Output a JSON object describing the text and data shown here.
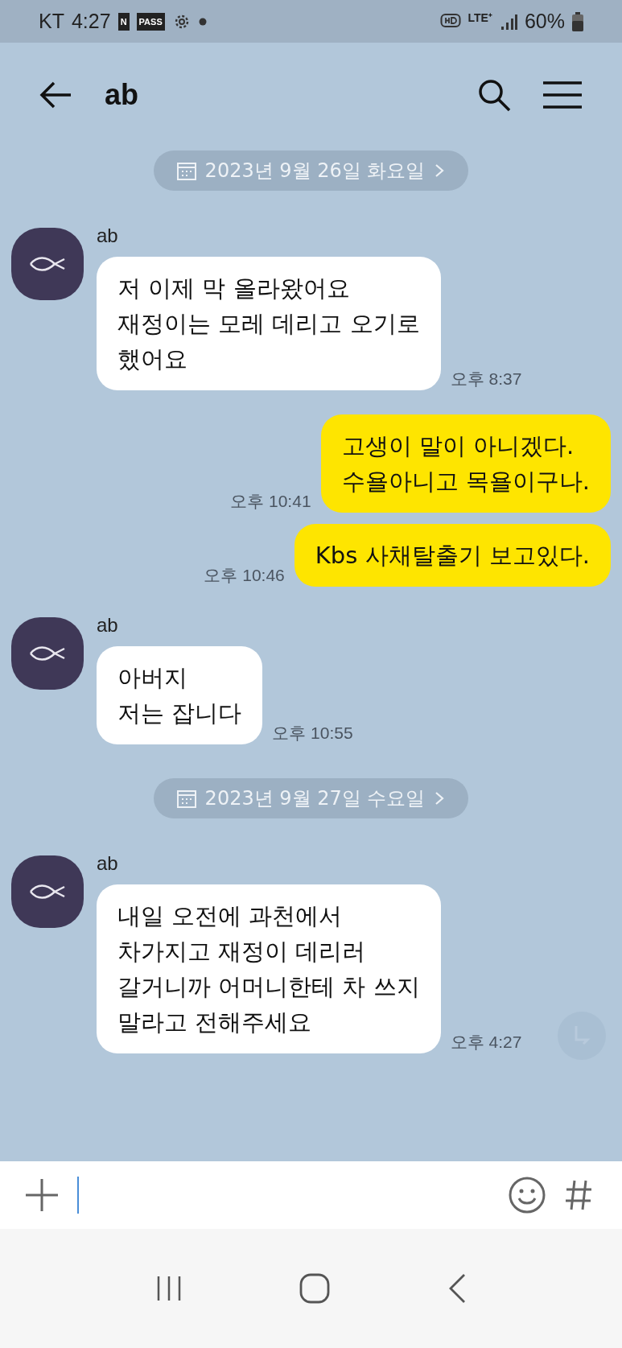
{
  "status_bar": {
    "carrier": "KT",
    "time": "4:27",
    "app_badges": [
      "N",
      "PASS"
    ],
    "battery": "60%",
    "network": "LTE⁺"
  },
  "header": {
    "title": "ab"
  },
  "messages": [
    {
      "kind": "date",
      "text": "2023년 9월 26일 화요일"
    },
    {
      "kind": "received",
      "sender": "ab",
      "lines": [
        "저 이제 막 올라왔어요",
        "재정이는 모레 데리고 오기로",
        "했어요"
      ],
      "time": "오후 8:37"
    },
    {
      "kind": "sent",
      "lines": [
        "고생이 말이 아니겠다.",
        "수욜아니고 목욜이구나."
      ],
      "time": "오후 10:41"
    },
    {
      "kind": "sent",
      "lines": [
        "Kbs 사채탈출기 보고있다."
      ],
      "time": "오후 10:46"
    },
    {
      "kind": "received",
      "sender": "ab",
      "lines": [
        "아버지",
        "저는 잡니다"
      ],
      "time": "오후 10:55"
    },
    {
      "kind": "date",
      "text": "2023년 9월 27일 수요일"
    },
    {
      "kind": "received",
      "sender": "ab",
      "lines": [
        "내일 오전에 과천에서",
        "차가지고 재정이 데리러",
        "갈거니까 어머니한테 차 쓰지",
        "말라고 전해주세요"
      ],
      "time": "오후 4:27"
    }
  ]
}
